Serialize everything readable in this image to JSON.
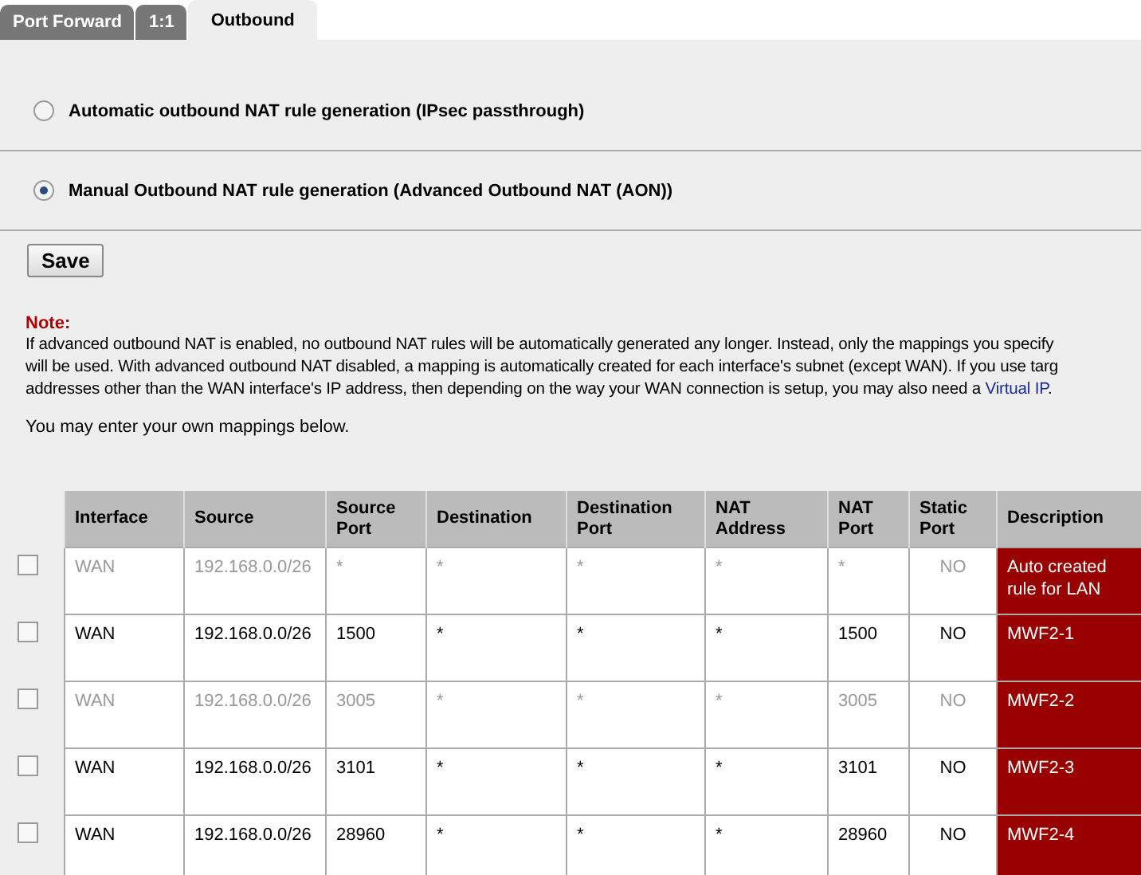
{
  "tabs": [
    {
      "label": "Port Forward",
      "selected": false
    },
    {
      "label": "1:1",
      "selected": false
    },
    {
      "label": "Outbound",
      "selected": true
    }
  ],
  "modes": [
    {
      "label": "Automatic outbound NAT rule generation (IPsec passthrough)",
      "selected": false
    },
    {
      "label": "Manual Outbound NAT rule generation (Advanced Outbound NAT (AON))",
      "selected": true
    }
  ],
  "save_button": "Save",
  "note": {
    "title": "Note:",
    "lines": [
      "If advanced outbound NAT is enabled, no outbound NAT rules will be automatically generated any longer. Instead, only the mappings you specify",
      "will be used. With advanced outbound NAT disabled, a mapping is automatically created for each interface's subnet (except WAN). If you use targ",
      "addresses other than the WAN interface's IP address, then depending on the way your WAN connection is setup, you may also need a"
    ],
    "link": "Virtual IP",
    "link_suffix": "."
  },
  "intro": "You may enter your own mappings below.",
  "table": {
    "columns": [
      "Interface",
      "Source",
      "Source Port",
      "Destination",
      "Destination Port",
      "NAT Address",
      "NAT Port",
      "Static Port",
      "Description"
    ],
    "rows": [
      {
        "checked": false,
        "disabled": true,
        "cells": [
          "WAN",
          "192.168.0.0/26",
          "*",
          "*",
          "*",
          "*",
          "*",
          "NO",
          "Auto created rule for LAN"
        ]
      },
      {
        "checked": false,
        "disabled": false,
        "cells": [
          "WAN",
          "192.168.0.0/26",
          "1500",
          "*",
          "*",
          "*",
          "1500",
          "NO",
          "MWF2-1"
        ]
      },
      {
        "checked": false,
        "disabled": true,
        "cells": [
          "WAN",
          "192.168.0.0/26",
          "3005",
          "*",
          "*",
          "*",
          "3005",
          "NO",
          "MWF2-2"
        ]
      },
      {
        "checked": false,
        "disabled": false,
        "cells": [
          "WAN",
          "192.168.0.0/26",
          "3101",
          "*",
          "*",
          "*",
          "3101",
          "NO",
          "MWF2-3"
        ]
      },
      {
        "checked": false,
        "disabled": false,
        "cells": [
          "WAN",
          "192.168.0.0/26",
          "28960",
          "*",
          "*",
          "*",
          "28960",
          "NO",
          "MWF2-4"
        ]
      }
    ]
  }
}
